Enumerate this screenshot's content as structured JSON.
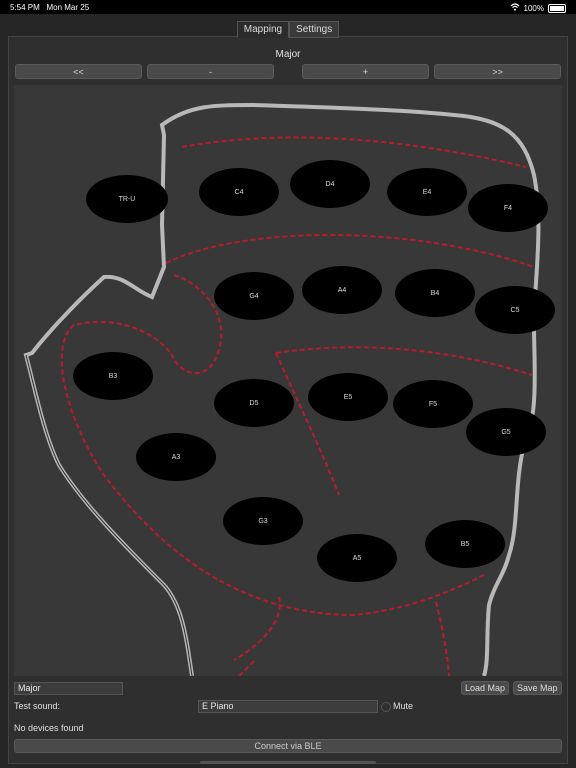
{
  "status": {
    "time": "5:54 PM",
    "date": "Mon Mar 25",
    "battery": "100%"
  },
  "tabs": [
    {
      "label": "Mapping",
      "active": true
    },
    {
      "label": "Settings",
      "active": false
    }
  ],
  "map_title": "Major",
  "nav": {
    "prev_fast": "<<",
    "minus": "-",
    "plus": "+",
    "next_fast": ">>"
  },
  "pads": [
    "TR-U",
    "C4",
    "D4",
    "E4",
    "F4",
    "G4",
    "A4",
    "B4",
    "C5",
    "B3",
    "D5",
    "E5",
    "F5",
    "G5",
    "A3",
    "G3",
    "A5",
    "B5"
  ],
  "bottom": {
    "map_name_value": "Major",
    "load_map": "Load Map",
    "save_map": "Save Map",
    "test_sound_label": "Test sound:",
    "test_sound_value": "E Piano",
    "mute_label": "Mute",
    "devices_status": "No devices found",
    "connect_ble": "Connect via BLE"
  },
  "colors": {
    "accent_dashed": "#b81c2c",
    "outline": "#b8b8b8",
    "pad": "#000000"
  }
}
